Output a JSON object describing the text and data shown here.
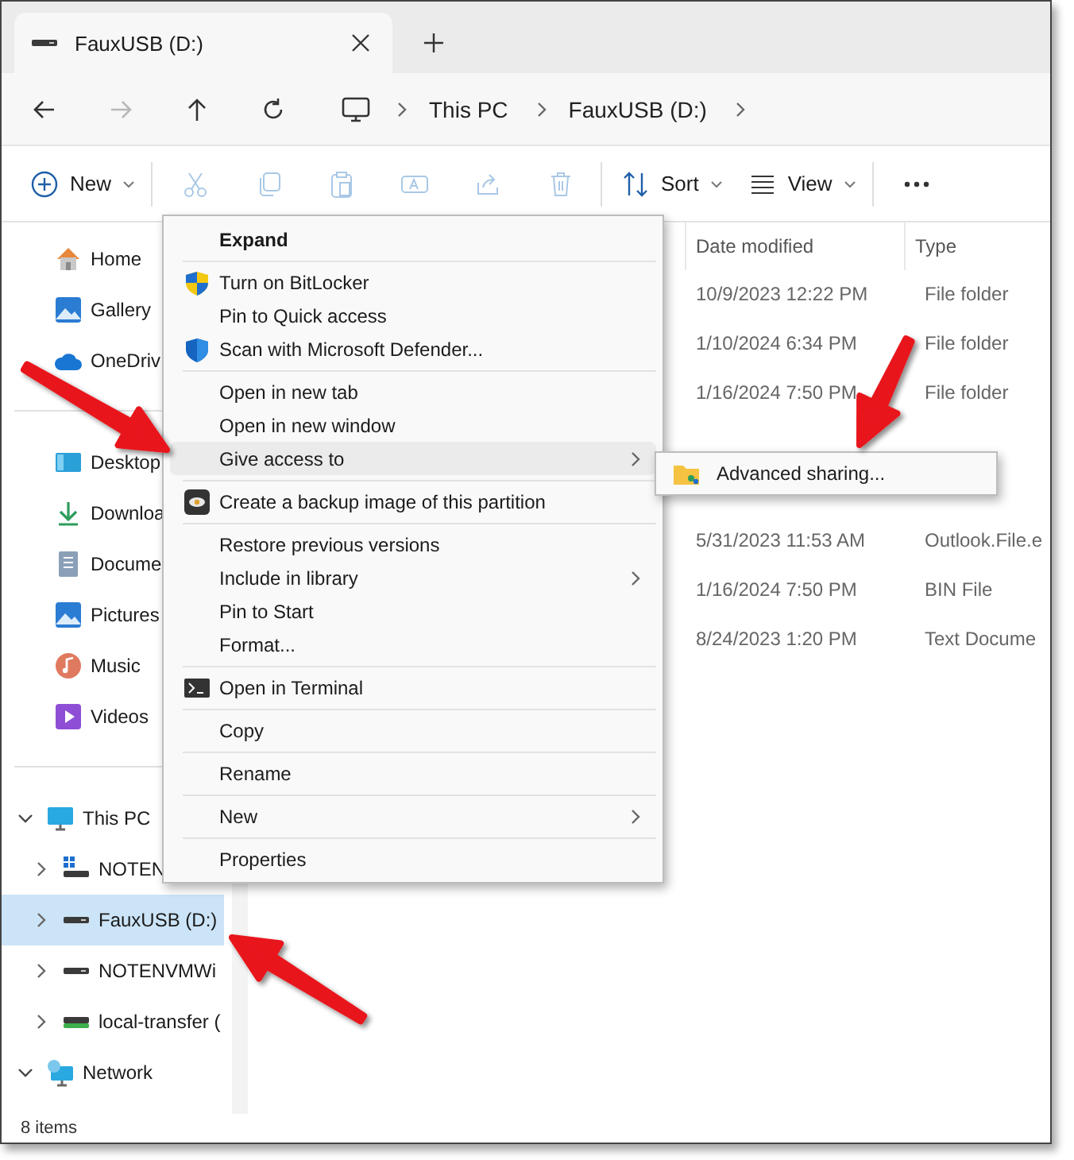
{
  "tab": {
    "title": "FauxUSB (D:)"
  },
  "navigation": {
    "buttons": [
      {
        "disabled": false
      },
      {
        "disabled": true
      },
      {
        "disabled": false
      },
      {
        "disabled": false
      }
    ],
    "breadcrumb": [
      "This PC",
      "FauxUSB (D:)"
    ]
  },
  "toolbar": {
    "buttons": [
      {
        "label": "New",
        "disabled": false,
        "dropdown": true
      },
      {
        "disabled": true
      },
      {
        "disabled": true
      },
      {
        "disabled": true
      },
      {
        "disabled": true
      },
      {
        "disabled": true
      },
      {
        "disabled": true
      },
      {
        "label": "Sort",
        "disabled": false,
        "dropdown": true
      },
      {
        "label": "View",
        "disabled": false,
        "dropdown": true
      },
      {
        "disabled": false
      }
    ]
  },
  "sidebar": {
    "groups": [
      {
        "items": [
          {
            "label": "Home"
          },
          {
            "label": "Gallery"
          },
          {
            "label": "OneDriv"
          }
        ]
      },
      {
        "items": [
          {
            "label": "Desktop"
          },
          {
            "label": "Downloa"
          },
          {
            "label": "Docume"
          },
          {
            "label": "Pictures"
          },
          {
            "label": "Music"
          },
          {
            "label": "Videos"
          }
        ]
      }
    ],
    "tree": [
      {
        "label": "This PC",
        "expanded": true,
        "selected": false,
        "children": [
          {
            "label": "NOTEN",
            "expanded": false,
            "selected": false
          },
          {
            "label": "FauxUSB (D:)",
            "expanded": false,
            "selected": true
          },
          {
            "label": "NOTENVMWi",
            "expanded": false,
            "selected": false
          },
          {
            "label": "local-transfer (",
            "expanded": false,
            "selected": false
          }
        ]
      },
      {
        "label": "Network",
        "expanded": true,
        "selected": false
      }
    ]
  },
  "file_list": {
    "columns": [
      "Date modified",
      "Type"
    ],
    "rows": [
      {
        "date_modified": "10/9/2023 12:22 PM",
        "type": "File folder"
      },
      {
        "date_modified": "1/10/2024 6:34 PM",
        "type": "File folder"
      },
      {
        "date_modified": "1/16/2024 7:50 PM",
        "type": "File folder"
      },
      {},
      {},
      {
        "date_modified": "5/31/2023 11:53 AM",
        "type": "Outlook.File.e"
      },
      {
        "date_modified": "1/16/2024 7:50 PM",
        "type": "BIN File"
      },
      {
        "date_modified": "8/24/2023 1:20 PM",
        "type": "Text Docume"
      }
    ]
  },
  "context_menu": {
    "items": [
      {
        "kind": "item",
        "label": "Expand",
        "bold": true,
        "submenu": false,
        "highlighted": false
      },
      {
        "kind": "separator"
      },
      {
        "kind": "item",
        "label": "Turn on BitLocker",
        "bold": false,
        "icon": true,
        "submenu": false,
        "highlighted": false
      },
      {
        "kind": "item",
        "label": "Pin to Quick access",
        "bold": false,
        "submenu": false,
        "highlighted": false
      },
      {
        "kind": "item",
        "label": "Scan with Microsoft Defender...",
        "bold": false,
        "icon": true,
        "submenu": false,
        "highlighted": false
      },
      {
        "kind": "separator"
      },
      {
        "kind": "item",
        "label": "Open in new tab",
        "bold": false,
        "submenu": false,
        "highlighted": false
      },
      {
        "kind": "item",
        "label": "Open in new window",
        "bold": false,
        "submenu": false,
        "highlighted": false
      },
      {
        "kind": "item",
        "label": "Give access to",
        "bold": false,
        "submenu": true,
        "highlighted": true
      },
      {
        "kind": "separator"
      },
      {
        "kind": "item",
        "label": "Create a backup image of this partition",
        "bold": false,
        "icon": true,
        "submenu": false,
        "highlighted": false
      },
      {
        "kind": "separator"
      },
      {
        "kind": "item",
        "label": "Restore previous versions",
        "bold": false,
        "submenu": false,
        "highlighted": false
      },
      {
        "kind": "item",
        "label": "Include in library",
        "bold": false,
        "submenu": true,
        "highlighted": false
      },
      {
        "kind": "item",
        "label": "Pin to Start",
        "bold": false,
        "submenu": false,
        "highlighted": false
      },
      {
        "kind": "item",
        "label": "Format...",
        "bold": false,
        "submenu": false,
        "highlighted": false
      },
      {
        "kind": "separator"
      },
      {
        "kind": "item",
        "label": "Open in Terminal",
        "bold": false,
        "icon": true,
        "submenu": false,
        "highlighted": false
      },
      {
        "kind": "separator"
      },
      {
        "kind": "item",
        "label": "Copy",
        "bold": false,
        "submenu": false,
        "highlighted": false
      },
      {
        "kind": "separator"
      },
      {
        "kind": "item",
        "label": "Rename",
        "bold": false,
        "submenu": false,
        "highlighted": false
      },
      {
        "kind": "separator"
      },
      {
        "kind": "item",
        "label": "New",
        "bold": false,
        "submenu": true,
        "highlighted": false
      },
      {
        "kind": "separator"
      },
      {
        "kind": "item",
        "label": "Properties",
        "bold": false,
        "submenu": false,
        "highlighted": false
      }
    ]
  },
  "submenu": {
    "items": [
      {
        "label": "Advanced sharing..."
      }
    ]
  },
  "status_bar": {
    "text": "8 items"
  }
}
